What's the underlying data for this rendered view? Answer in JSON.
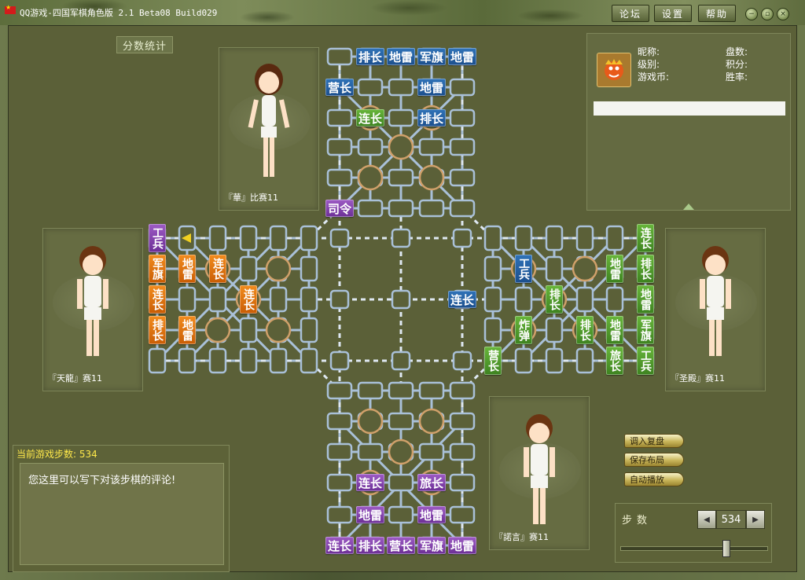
{
  "window": {
    "title": "QQ游戏-四国军棋角色版 2.1 Beta08 Build029",
    "buttons": [
      "论坛",
      "设置",
      "帮助"
    ],
    "controls": [
      "minimize",
      "restore",
      "close"
    ]
  },
  "stats_button": "分数统计",
  "players": [
    {
      "name": "『華』比赛11",
      "avatar": "girl",
      "position": "top"
    },
    {
      "name": "『天龍』赛11",
      "avatar": "boy",
      "position": "left"
    },
    {
      "name": "『圣殿』赛11",
      "avatar": "boy",
      "position": "right"
    },
    {
      "name": "『諾言』赛11",
      "avatar": "boy",
      "position": "bottom"
    }
  ],
  "info": {
    "labels": [
      "昵称:",
      "级别:",
      "游戏币:",
      "盘数:",
      "积分:",
      "胜率:"
    ],
    "icon": "game-icon"
  },
  "steps": {
    "header": "当前游戏步数: 534",
    "comment": "您这里可以写下对该步棋的评论!"
  },
  "replay_buttons": [
    "调入复盘",
    "保存布局",
    "自动播放"
  ],
  "step_control": {
    "label": "步数",
    "value": "534",
    "slider_fraction": 0.76
  },
  "pieces": {
    "top_blue": [
      "排长",
      "地雷",
      "军旗",
      "地雷",
      "营长",
      "地雷",
      "排长"
    ],
    "top_green": [
      "连长"
    ],
    "purple_top": [
      "司令"
    ],
    "bottom_purple": [
      "连长",
      "旅长",
      "地雷",
      "地雷",
      "连长",
      "排长",
      "营长",
      "军旗",
      "地雷"
    ],
    "left_purple": [
      "工兵"
    ],
    "left_orange": [
      "军旗",
      "地雷",
      "连长",
      "连长",
      "排长",
      "地雷",
      "连长"
    ],
    "center_blue": [
      "连长"
    ],
    "right_blue": [
      "工兵"
    ],
    "right_green": [
      "连长",
      "排长",
      "地雷",
      "排长",
      "地雷",
      "军旗",
      "工兵",
      "旅长",
      "地雷",
      "炸弹",
      "排长",
      "营长"
    ]
  },
  "colors": {
    "blue": "#2f73b8",
    "green": "#68b63b",
    "purple": "#9d5bc4",
    "orange": "#f28c1e"
  }
}
